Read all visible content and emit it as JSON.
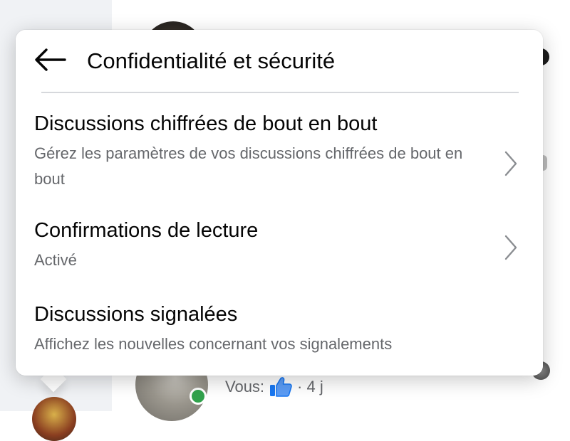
{
  "popup": {
    "title": "Confidentialité et sécurité",
    "back_icon": "arrow-left-icon"
  },
  "menu": {
    "items": [
      {
        "label": "Discussions chiffrées de bout en bout",
        "description": "Gérez les paramètres de vos discussions chiffrées de bout en bout",
        "icon": "chevron-right-icon"
      },
      {
        "label": "Confirmations de lecture",
        "description": "Activé",
        "icon": "chevron-right-icon"
      },
      {
        "label": "Discussions signalées",
        "description": "Affichez les nouvelles concernant vos signalements"
      }
    ]
  },
  "background": {
    "preview_sender": "Vous:",
    "preview_icon": "thumbs-up-icon",
    "preview_time": "· 4 j"
  },
  "colors": {
    "title_text": "#050505",
    "secondary_text": "#65676b",
    "online": "#31a24c",
    "like_blue": "#1877f2"
  }
}
